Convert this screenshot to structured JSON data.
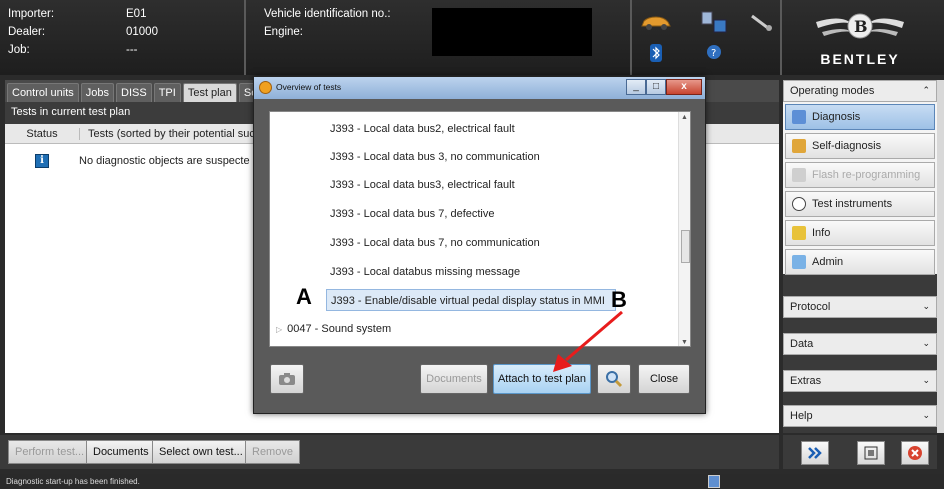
{
  "header": {
    "importer_label": "Importer:",
    "importer_value": "E01",
    "dealer_label": "Dealer:",
    "dealer_value": "01000",
    "job_label": "Job:",
    "job_value": "---",
    "vin_label": "Vehicle identification no.:",
    "engine_label": "Engine:",
    "brand": "BENTLEY"
  },
  "tabs": [
    {
      "label": "Control units"
    },
    {
      "label": "Jobs"
    },
    {
      "label": "DISS"
    },
    {
      "label": "TPI"
    },
    {
      "label": "Test plan"
    },
    {
      "label": "Seque"
    }
  ],
  "tests": {
    "title": "Tests in current test plan",
    "col_status": "Status",
    "col_tests": "Tests (sorted by their potential suc",
    "row_text": "No diagnostic objects are suspecte"
  },
  "bottom_buttons": {
    "perform": "Perform test...",
    "documents": "Documents",
    "select_own": "Select own test...",
    "remove": "Remove"
  },
  "status_bar": {
    "text": "Diagnostic start-up has been finished."
  },
  "right_panel": {
    "operating_modes": "Operating modes",
    "modes": [
      {
        "label": "Diagnosis"
      },
      {
        "label": "Self-diagnosis"
      },
      {
        "label": "Flash re-programming"
      },
      {
        "label": "Test instruments"
      },
      {
        "label": "Info"
      },
      {
        "label": "Admin"
      }
    ],
    "protocol": "Protocol",
    "data": "Data",
    "extras": "Extras",
    "help": "Help"
  },
  "dialog": {
    "title": "Overview of tests",
    "items": [
      {
        "label": "J393 - Local data bus2, electrical fault"
      },
      {
        "label": "J393 - Local data bus 3, no communication"
      },
      {
        "label": "J393 - Local data bus3, electrical fault"
      },
      {
        "label": "J393 - Local data bus 7, defective"
      },
      {
        "label": "J393 - Local data bus 7, no communication"
      },
      {
        "label": "J393 - Local databus missing message"
      },
      {
        "label": "J393 - Enable/disable virtual pedal display status in MMI"
      }
    ],
    "group_label": "0047 - Sound system",
    "btn_documents": "Documents",
    "btn_attach": "Attach to test plan",
    "btn_close": "Close"
  },
  "annotations": {
    "a": "A",
    "b": "B"
  },
  "colors": {
    "accent": "#9ec1e6",
    "arrow": "#e81c1c"
  }
}
